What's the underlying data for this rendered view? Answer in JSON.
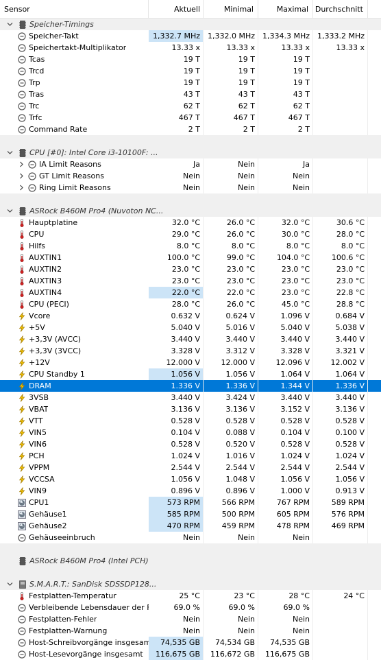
{
  "header": {
    "sensor": "Sensor",
    "current": "Aktuell",
    "min": "Minimal",
    "max": "Maximal",
    "avg": "Durchschnitt"
  },
  "colors": {
    "selection": "#0078d7",
    "highlight": "#cce4f7"
  },
  "rows": [
    {
      "type": "group",
      "label": "Speicher-Timings",
      "icon": "memory-chip-icon",
      "expanded": true
    },
    {
      "type": "item",
      "icon": "clock-icon",
      "label": "Speicher-Takt",
      "v": [
        "1,332.7 MHz",
        "1,332.0 MHz",
        "1,334.3 MHz",
        "1,333.2 MHz"
      ],
      "hl": true
    },
    {
      "type": "item",
      "icon": "clock-icon",
      "label": "Speichertakt-Multiplikator",
      "v": [
        "13.33 x",
        "13.33 x",
        "13.33 x",
        "13.33 x"
      ]
    },
    {
      "type": "item",
      "icon": "clock-icon",
      "label": "Tcas",
      "v": [
        "19 T",
        "19 T",
        "19 T",
        ""
      ]
    },
    {
      "type": "item",
      "icon": "clock-icon",
      "label": "Trcd",
      "v": [
        "19 T",
        "19 T",
        "19 T",
        ""
      ]
    },
    {
      "type": "item",
      "icon": "clock-icon",
      "label": "Trp",
      "v": [
        "19 T",
        "19 T",
        "19 T",
        ""
      ]
    },
    {
      "type": "item",
      "icon": "clock-icon",
      "label": "Tras",
      "v": [
        "43 T",
        "43 T",
        "43 T",
        ""
      ]
    },
    {
      "type": "item",
      "icon": "clock-icon",
      "label": "Trc",
      "v": [
        "62 T",
        "62 T",
        "62 T",
        ""
      ]
    },
    {
      "type": "item",
      "icon": "clock-icon",
      "label": "Trfc",
      "v": [
        "467 T",
        "467 T",
        "467 T",
        ""
      ]
    },
    {
      "type": "item",
      "icon": "clock-icon",
      "label": "Command Rate",
      "v": [
        "2 T",
        "2 T",
        "2 T",
        ""
      ]
    },
    {
      "type": "sep"
    },
    {
      "type": "group",
      "label": "CPU [#0]: Intel Core i3-10100F: ...",
      "icon": "memory-chip-icon",
      "expanded": true
    },
    {
      "type": "item",
      "icon": "clock-icon",
      "label": "IA Limit Reasons",
      "v": [
        "Ja",
        "Nein",
        "Ja",
        ""
      ],
      "sub": true
    },
    {
      "type": "item",
      "icon": "clock-icon",
      "label": "GT Limit Reasons",
      "v": [
        "Nein",
        "Nein",
        "Nein",
        ""
      ],
      "sub": true
    },
    {
      "type": "item",
      "icon": "clock-icon",
      "label": "Ring Limit Reasons",
      "v": [
        "Nein",
        "Nein",
        "Nein",
        ""
      ],
      "sub": true
    },
    {
      "type": "sep"
    },
    {
      "type": "group",
      "label": "ASRock B460M Pro4 (Nuvoton NC...",
      "icon": "memory-chip-icon",
      "expanded": true
    },
    {
      "type": "item",
      "icon": "thermometer-icon",
      "label": "Hauptplatine",
      "v": [
        "32.0 °C",
        "26.0 °C",
        "32.0 °C",
        "30.6 °C"
      ]
    },
    {
      "type": "item",
      "icon": "thermometer-icon",
      "label": "CPU",
      "v": [
        "29.0 °C",
        "26.0 °C",
        "30.0 °C",
        "28.0 °C"
      ]
    },
    {
      "type": "item",
      "icon": "thermometer-icon",
      "label": "Hilfs",
      "v": [
        "8.0 °C",
        "8.0 °C",
        "8.0 °C",
        "8.0 °C"
      ]
    },
    {
      "type": "item",
      "icon": "thermometer-icon",
      "label": "AUXTIN1",
      "v": [
        "100.0 °C",
        "99.0 °C",
        "104.0 °C",
        "100.6 °C"
      ]
    },
    {
      "type": "item",
      "icon": "thermometer-icon",
      "label": "AUXTIN2",
      "v": [
        "23.0 °C",
        "23.0 °C",
        "23.0 °C",
        "23.0 °C"
      ]
    },
    {
      "type": "item",
      "icon": "thermometer-icon",
      "label": "AUXTIN3",
      "v": [
        "23.0 °C",
        "23.0 °C",
        "23.0 °C",
        "23.0 °C"
      ]
    },
    {
      "type": "item",
      "icon": "thermometer-icon",
      "label": "AUXTIN4",
      "v": [
        "22.0 °C",
        "22.0 °C",
        "23.0 °C",
        "22.8 °C"
      ],
      "hl": true
    },
    {
      "type": "item",
      "icon": "thermometer-icon",
      "label": "CPU (PECI)",
      "v": [
        "28.0 °C",
        "26.0 °C",
        "45.0 °C",
        "28.8 °C"
      ]
    },
    {
      "type": "item",
      "icon": "lightning-icon",
      "label": "Vcore",
      "v": [
        "0.632 V",
        "0.624 V",
        "1.096 V",
        "0.684 V"
      ]
    },
    {
      "type": "item",
      "icon": "lightning-icon",
      "label": "+5V",
      "v": [
        "5.040 V",
        "5.016 V",
        "5.040 V",
        "5.038 V"
      ]
    },
    {
      "type": "item",
      "icon": "lightning-icon",
      "label": "+3,3V (AVCC)",
      "v": [
        "3.440 V",
        "3.440 V",
        "3.440 V",
        "3.440 V"
      ]
    },
    {
      "type": "item",
      "icon": "lightning-icon",
      "label": "+3,3V (3VCC)",
      "v": [
        "3.328 V",
        "3.312 V",
        "3.328 V",
        "3.321 V"
      ]
    },
    {
      "type": "item",
      "icon": "lightning-icon",
      "label": "+12V",
      "v": [
        "12.000 V",
        "12.000 V",
        "12.096 V",
        "12.002 V"
      ]
    },
    {
      "type": "item",
      "icon": "lightning-icon",
      "label": "CPU Standby 1",
      "v": [
        "1.056 V",
        "1.056 V",
        "1.064 V",
        "1.064 V"
      ],
      "hl": true
    },
    {
      "type": "item",
      "icon": "lightning-icon",
      "label": "DRAM",
      "v": [
        "1.336 V",
        "1.336 V",
        "1.344 V",
        "1.336 V"
      ],
      "sel": true
    },
    {
      "type": "item",
      "icon": "lightning-icon",
      "label": "3VSB",
      "v": [
        "3.440 V",
        "3.424 V",
        "3.440 V",
        "3.440 V"
      ]
    },
    {
      "type": "item",
      "icon": "lightning-icon",
      "label": "VBAT",
      "v": [
        "3.136 V",
        "3.136 V",
        "3.152 V",
        "3.136 V"
      ]
    },
    {
      "type": "item",
      "icon": "lightning-icon",
      "label": "VTT",
      "v": [
        "0.528 V",
        "0.528 V",
        "0.528 V",
        "0.528 V"
      ]
    },
    {
      "type": "item",
      "icon": "lightning-icon",
      "label": "VIN5",
      "v": [
        "0.104 V",
        "0.088 V",
        "0.104 V",
        "0.100 V"
      ]
    },
    {
      "type": "item",
      "icon": "lightning-icon",
      "label": "VIN6",
      "v": [
        "0.528 V",
        "0.520 V",
        "0.528 V",
        "0.528 V"
      ]
    },
    {
      "type": "item",
      "icon": "lightning-icon",
      "label": "PCH",
      "v": [
        "1.024 V",
        "1.016 V",
        "1.024 V",
        "1.024 V"
      ]
    },
    {
      "type": "item",
      "icon": "lightning-icon",
      "label": "VPPM",
      "v": [
        "2.544 V",
        "2.544 V",
        "2.544 V",
        "2.544 V"
      ]
    },
    {
      "type": "item",
      "icon": "lightning-icon",
      "label": "VCCSA",
      "v": [
        "1.056 V",
        "1.048 V",
        "1.056 V",
        "1.056 V"
      ]
    },
    {
      "type": "item",
      "icon": "lightning-icon",
      "label": "VIN9",
      "v": [
        "0.896 V",
        "0.896 V",
        "1.000 V",
        "0.913 V"
      ]
    },
    {
      "type": "item",
      "icon": "fan-icon",
      "label": "CPU1",
      "v": [
        "573 RPM",
        "566 RPM",
        "767 RPM",
        "589 RPM"
      ],
      "hl": true
    },
    {
      "type": "item",
      "icon": "fan-icon",
      "label": "Gehäuse1",
      "v": [
        "585 RPM",
        "500 RPM",
        "605 RPM",
        "576 RPM"
      ],
      "hl": true
    },
    {
      "type": "item",
      "icon": "fan-icon",
      "label": "Gehäuse2",
      "v": [
        "470 RPM",
        "459 RPM",
        "478 RPM",
        "469 RPM"
      ],
      "hl": true
    },
    {
      "type": "item",
      "icon": "clock-icon",
      "label": "Gehäuseeinbruch",
      "v": [
        "Nein",
        "Nein",
        "Nein",
        ""
      ]
    },
    {
      "type": "sep"
    },
    {
      "type": "group",
      "label": "ASRock B460M Pro4 (Intel PCH)",
      "icon": "memory-chip-icon",
      "expanded": false,
      "nochev": true
    },
    {
      "type": "sep"
    },
    {
      "type": "group",
      "label": "S.M.A.R.T.: SanDisk SDSSDP128...",
      "icon": "disk-icon",
      "expanded": true
    },
    {
      "type": "item",
      "icon": "thermometer-icon",
      "label": "Festplatten-Temperatur",
      "v": [
        "25 °C",
        "23 °C",
        "28 °C",
        "24 °C"
      ]
    },
    {
      "type": "item",
      "icon": "clock-icon",
      "label": "Verbleibende Lebensdauer der Fe...",
      "v": [
        "69.0 %",
        "69.0 %",
        "69.0 %",
        ""
      ]
    },
    {
      "type": "item",
      "icon": "clock-icon",
      "label": "Festplatten-Fehler",
      "v": [
        "Nein",
        "Nein",
        "Nein",
        ""
      ]
    },
    {
      "type": "item",
      "icon": "clock-icon",
      "label": "Festplatten-Warnung",
      "v": [
        "Nein",
        "Nein",
        "Nein",
        ""
      ]
    },
    {
      "type": "item",
      "icon": "clock-icon",
      "label": "Host-Schreibvorgänge insgesamt",
      "v": [
        "74,535 GB",
        "74,534 GB",
        "74,535 GB",
        ""
      ],
      "hl": true
    },
    {
      "type": "item",
      "icon": "clock-icon",
      "label": "Host-Lesevorgänge insgesamt",
      "v": [
        "116,675 GB",
        "116,672 GB",
        "116,675 GB",
        ""
      ],
      "hl": true
    }
  ]
}
